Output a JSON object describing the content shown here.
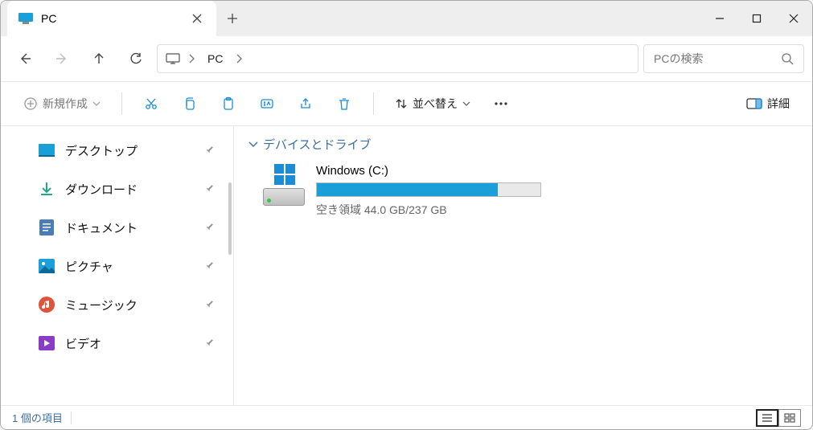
{
  "tab": {
    "title": "PC"
  },
  "breadcrumb": {
    "crumb1": "PC"
  },
  "search": {
    "placeholder": "PCの検索"
  },
  "toolbar": {
    "new_label": "新規作成",
    "sort_label": "並べ替え",
    "details_label": "詳細"
  },
  "sidebar": {
    "items": [
      {
        "label": "デスクトップ"
      },
      {
        "label": "ダウンロード"
      },
      {
        "label": "ドキュメント"
      },
      {
        "label": "ピクチャ"
      },
      {
        "label": "ミュージック"
      },
      {
        "label": "ビデオ"
      }
    ]
  },
  "main": {
    "group_header": "デバイスとドライブ",
    "drive": {
      "name": "Windows (C:)",
      "subtitle": "空き領域 44.0 GB/237 GB",
      "fill_percent": "81"
    }
  },
  "status": {
    "item_count": "1 個の項目"
  }
}
